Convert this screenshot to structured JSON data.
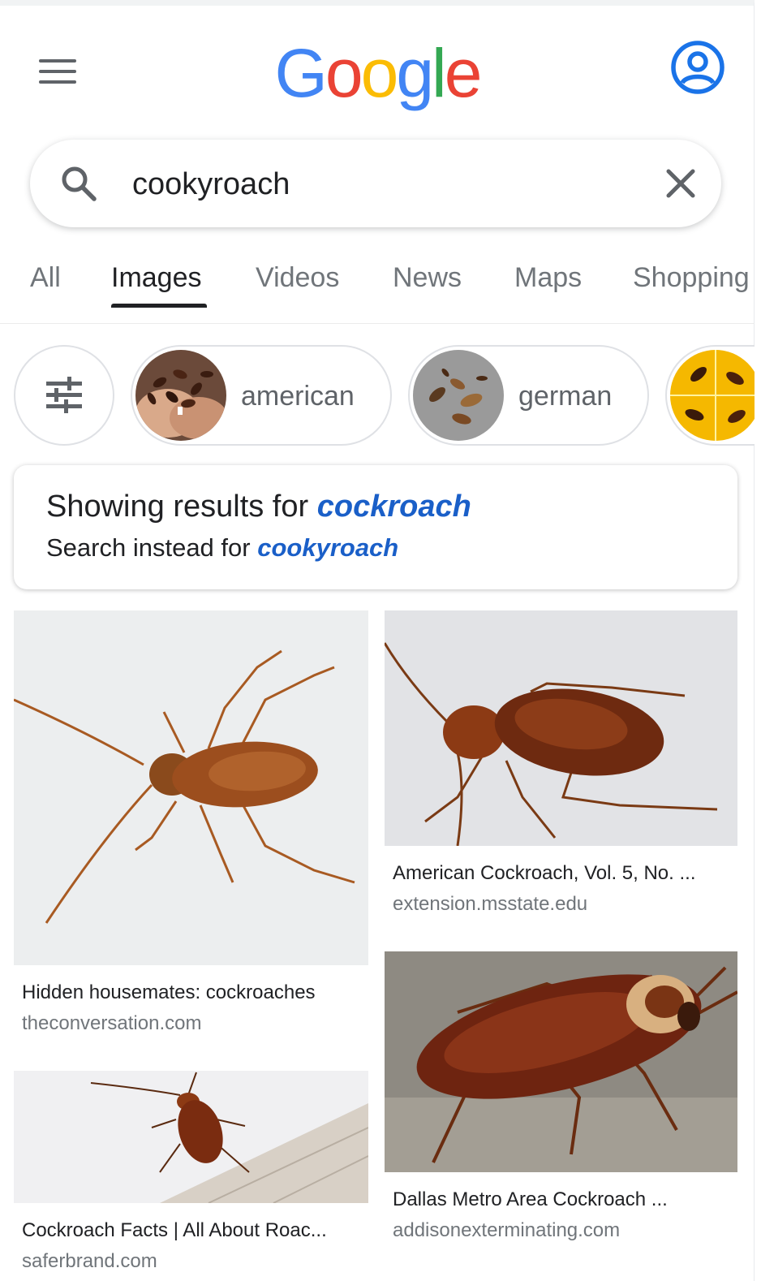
{
  "header": {
    "logo_text": "Google",
    "menu_icon": "hamburger-menu-icon",
    "account_icon": "account-circle-icon"
  },
  "search": {
    "query": "cookyroach",
    "search_icon": "search-icon",
    "clear_icon": "close-icon"
  },
  "tabs": [
    {
      "label": "All",
      "active": false
    },
    {
      "label": "Images",
      "active": true
    },
    {
      "label": "Videos",
      "active": false
    },
    {
      "label": "News",
      "active": false
    },
    {
      "label": "Maps",
      "active": false
    },
    {
      "label": "Shopping",
      "active": false
    }
  ],
  "chips": {
    "filter_icon": "tune-filter-icon",
    "items": [
      {
        "label": "american"
      },
      {
        "label": "german"
      },
      {
        "label": ""
      }
    ]
  },
  "spelling": {
    "showing_prefix": "Showing results for",
    "corrected_query": "cockroach",
    "instead_prefix": "Search instead for",
    "original_query": "cookyroach"
  },
  "results": [
    {
      "title": "Hidden housemates: cockroaches",
      "source": "theconversation.com"
    },
    {
      "title": "American Cockroach, Vol. 5, No. ...",
      "source": "extension.msstate.edu"
    },
    {
      "title": "Cockroach Facts | All About Roac...",
      "source": "saferbrand.com"
    },
    {
      "title": "Dallas Metro Area Cockroach ...",
      "source": "addisonexterminating.com"
    }
  ],
  "colors": {
    "link_blue": "#1a5fc8",
    "account_blue": "#1a73e8",
    "chip_border": "#dfe1e5"
  }
}
